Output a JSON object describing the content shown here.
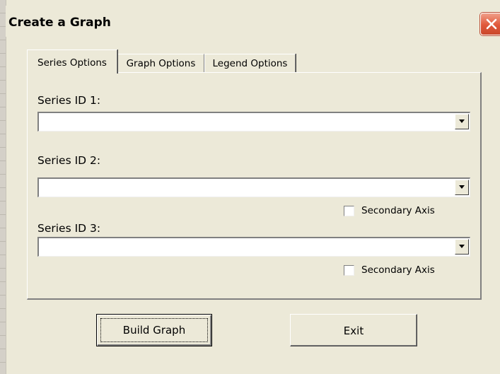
{
  "window": {
    "title": "Create a Graph"
  },
  "tabs": [
    {
      "label": "Series Options",
      "active": true
    },
    {
      "label": "Graph Options",
      "active": false
    },
    {
      "label": "Legend Options",
      "active": false
    }
  ],
  "series": [
    {
      "label": "Series ID 1:",
      "value": "",
      "secondary_axis": null
    },
    {
      "label": "Series ID 2:",
      "value": "",
      "secondary_axis": {
        "label": "Secondary Axis",
        "checked": false
      }
    },
    {
      "label": "Series ID 3:",
      "value": "",
      "secondary_axis": {
        "label": "Secondary Axis",
        "checked": false
      }
    }
  ],
  "buttons": {
    "build": "Build Graph",
    "exit": "Exit"
  },
  "icons": {
    "close": "close-icon",
    "dropdown": "chevron-down-icon"
  },
  "colors": {
    "dialog_bg": "#ece9d8",
    "close_red": "#e0583a"
  }
}
